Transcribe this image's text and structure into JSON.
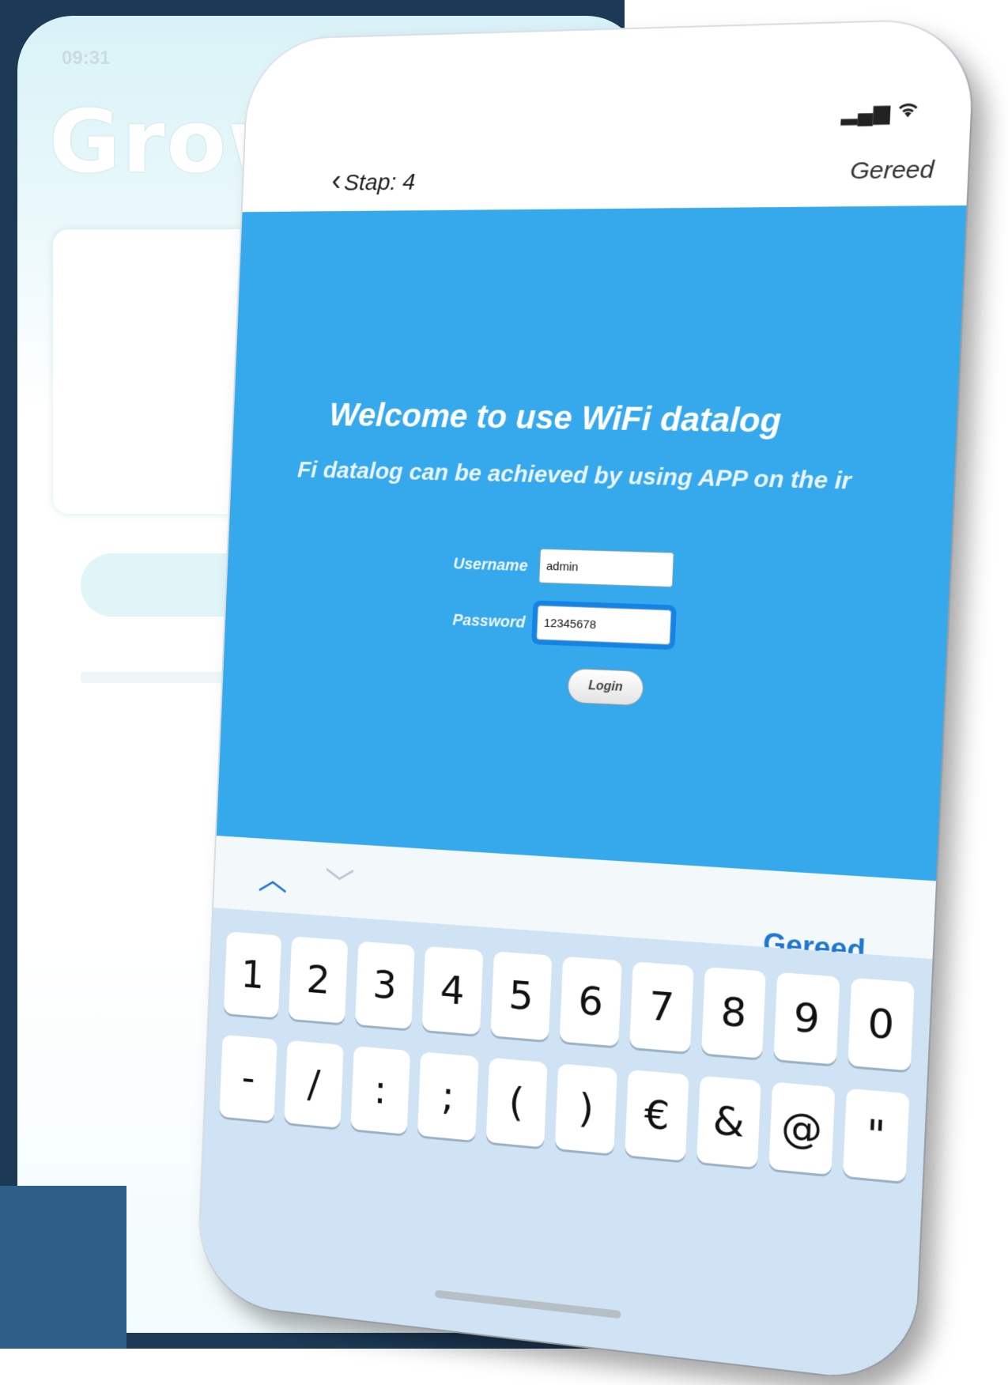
{
  "background_app": {
    "time": "09:31",
    "logo": "Growatt"
  },
  "status": {
    "signal_icon": "signal-icon",
    "wifi_icon": "wifi-icon"
  },
  "nav": {
    "back_label": "Stap: 4",
    "done_label": "Gereed"
  },
  "page": {
    "title": "Welcome to use WiFi datalog",
    "subtitle": "Fi datalog can be achieved by using APP on the ir",
    "username_label": "Username",
    "username_value": "admin",
    "password_label": "Password",
    "password_value": "12345678",
    "login_label": "Login"
  },
  "keyboard_accessory": {
    "up_icon": "chevron-up-icon",
    "down_icon": "chevron-down-icon",
    "done_label": "Gereed"
  },
  "keyboard": {
    "row1": [
      "1",
      "2",
      "3",
      "4",
      "5",
      "6",
      "7",
      "8",
      "9",
      "0"
    ],
    "row2": [
      "-",
      "/",
      ":",
      ";",
      "(",
      ")",
      "€",
      "&",
      "@",
      "\""
    ]
  },
  "colors": {
    "web_background": "#36a9ec",
    "accent": "#1f77d0",
    "frame": "#1c3a56"
  }
}
